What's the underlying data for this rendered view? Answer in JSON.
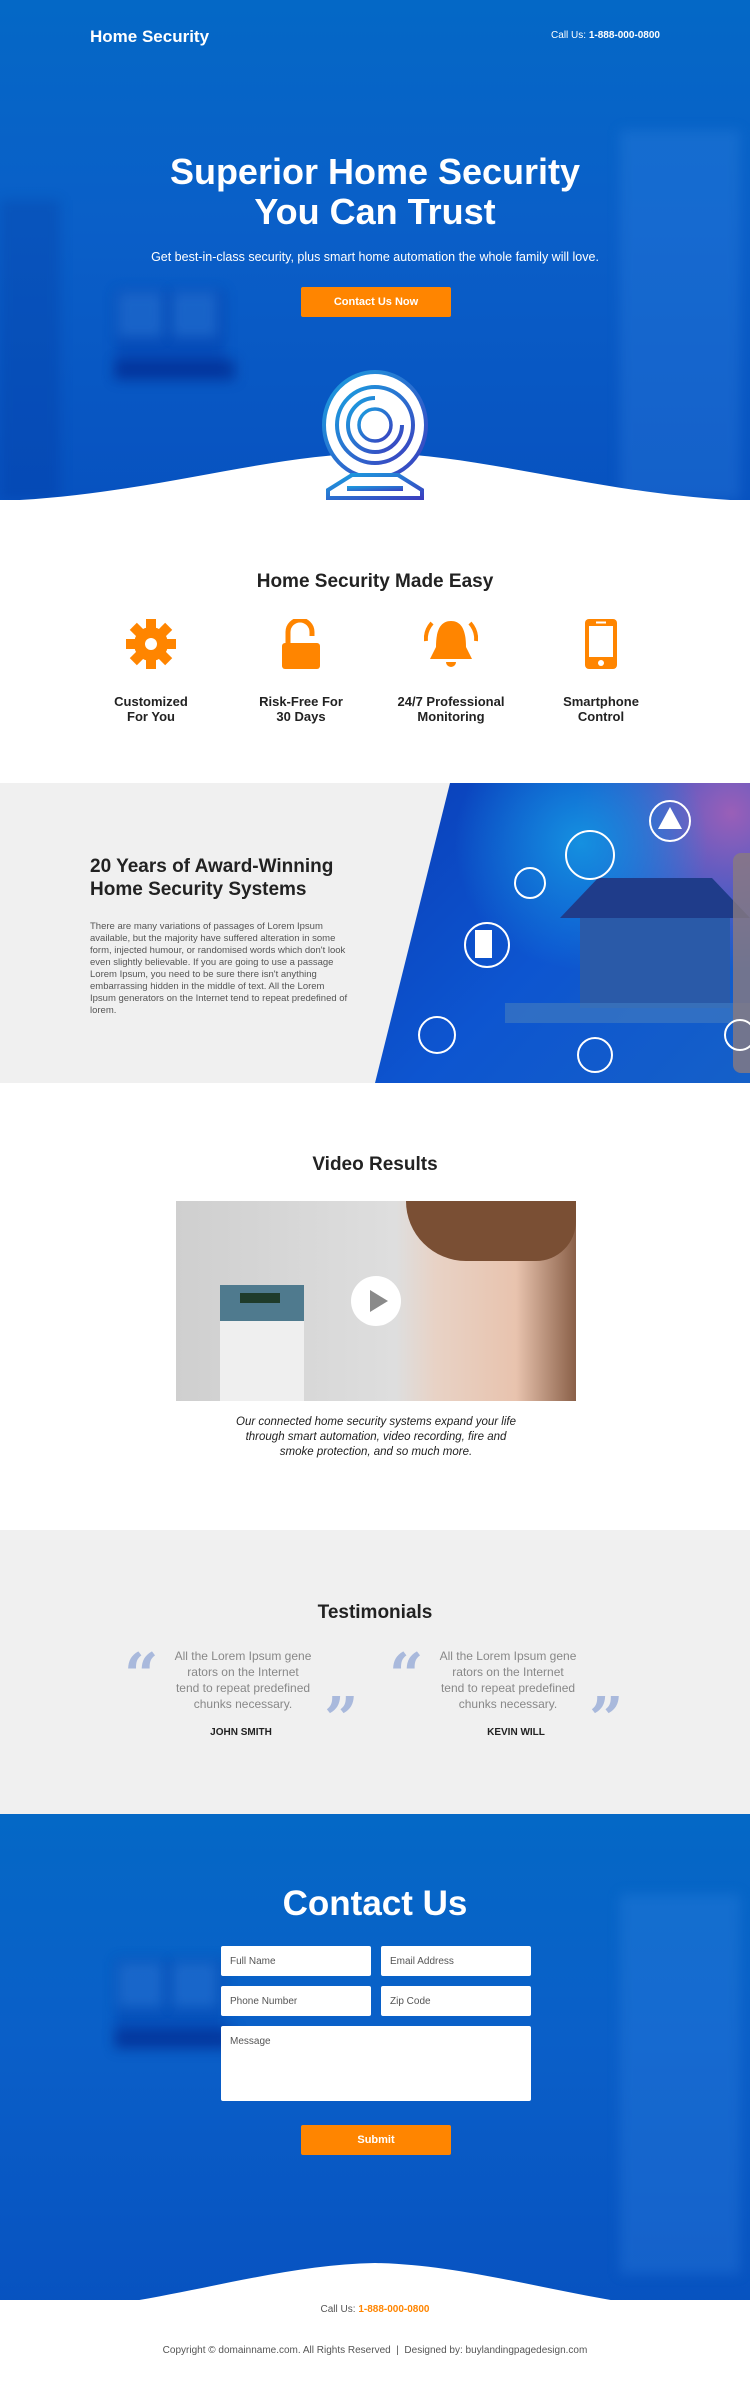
{
  "colors": {
    "accent": "#ff8500",
    "brand_blue": "#0468c6",
    "section_gray": "#f0f0f0"
  },
  "header": {
    "logo": "Home Security",
    "call_label": "Call Us:",
    "phone": "1-888-000-0800"
  },
  "hero": {
    "title_line1": "Superior Home Security",
    "title_line2": "You Can Trust",
    "subtitle": "Get best-in-class security, plus smart home automation the whole family will love.",
    "cta": "Contact Us Now",
    "icon": "webcam-icon"
  },
  "features": {
    "title": "Home Security Made Easy",
    "items": [
      {
        "label": "Customized\nFor You",
        "icon": "gear-icon"
      },
      {
        "label": "Risk-Free For\n30 Days",
        "icon": "unlock-icon"
      },
      {
        "label": "24/7 Professional\nMonitoring",
        "icon": "bell-icon"
      },
      {
        "label": "Smartphone\nControl",
        "icon": "smartphone-icon"
      }
    ]
  },
  "about": {
    "title_line1": "20 Years of Award-Winning",
    "title_line2": "Home Security Systems",
    "body": "There are many variations of passages of Lorem Ipsum available, but the majority have suffered alteration in some form, injected humour, or randomised words which don't look even slightly believable. If you are going to use a passage Lorem Ipsum, you need to be sure there isn't anything embarrassing hidden in the middle of text. All the Lorem Ipsum generators on the Internet tend to repeat predefined of lorem."
  },
  "video": {
    "title": "Video Results",
    "caption": "Our connected home security systems expand your life through smart automation, video recording, fire and smoke protection, and so much more."
  },
  "testimonials": {
    "title": "Testimonials",
    "items": [
      {
        "quote": "All the Lorem Ipsum gene\nrators on the Internet\ntend to repeat predefined\nchunks necessary.",
        "name": "JOHN SMITH"
      },
      {
        "quote": "All the Lorem Ipsum gene\nrators on the Internet\ntend to repeat predefined\nchunks necessary.",
        "name": "KEVIN WILL"
      }
    ]
  },
  "contact": {
    "title": "Contact Us",
    "full_name": "Full Name",
    "email": "Email Address",
    "phone": "Phone Number",
    "zip": "Zip Code",
    "message": "Message",
    "submit": "Submit"
  },
  "footer": {
    "call_label": "Call Us:",
    "phone": "1-888-000-0800",
    "copyright": "Copyright © domainname.com. All Rights Reserved  |  Designed by: buylandingpagedesign.com"
  }
}
